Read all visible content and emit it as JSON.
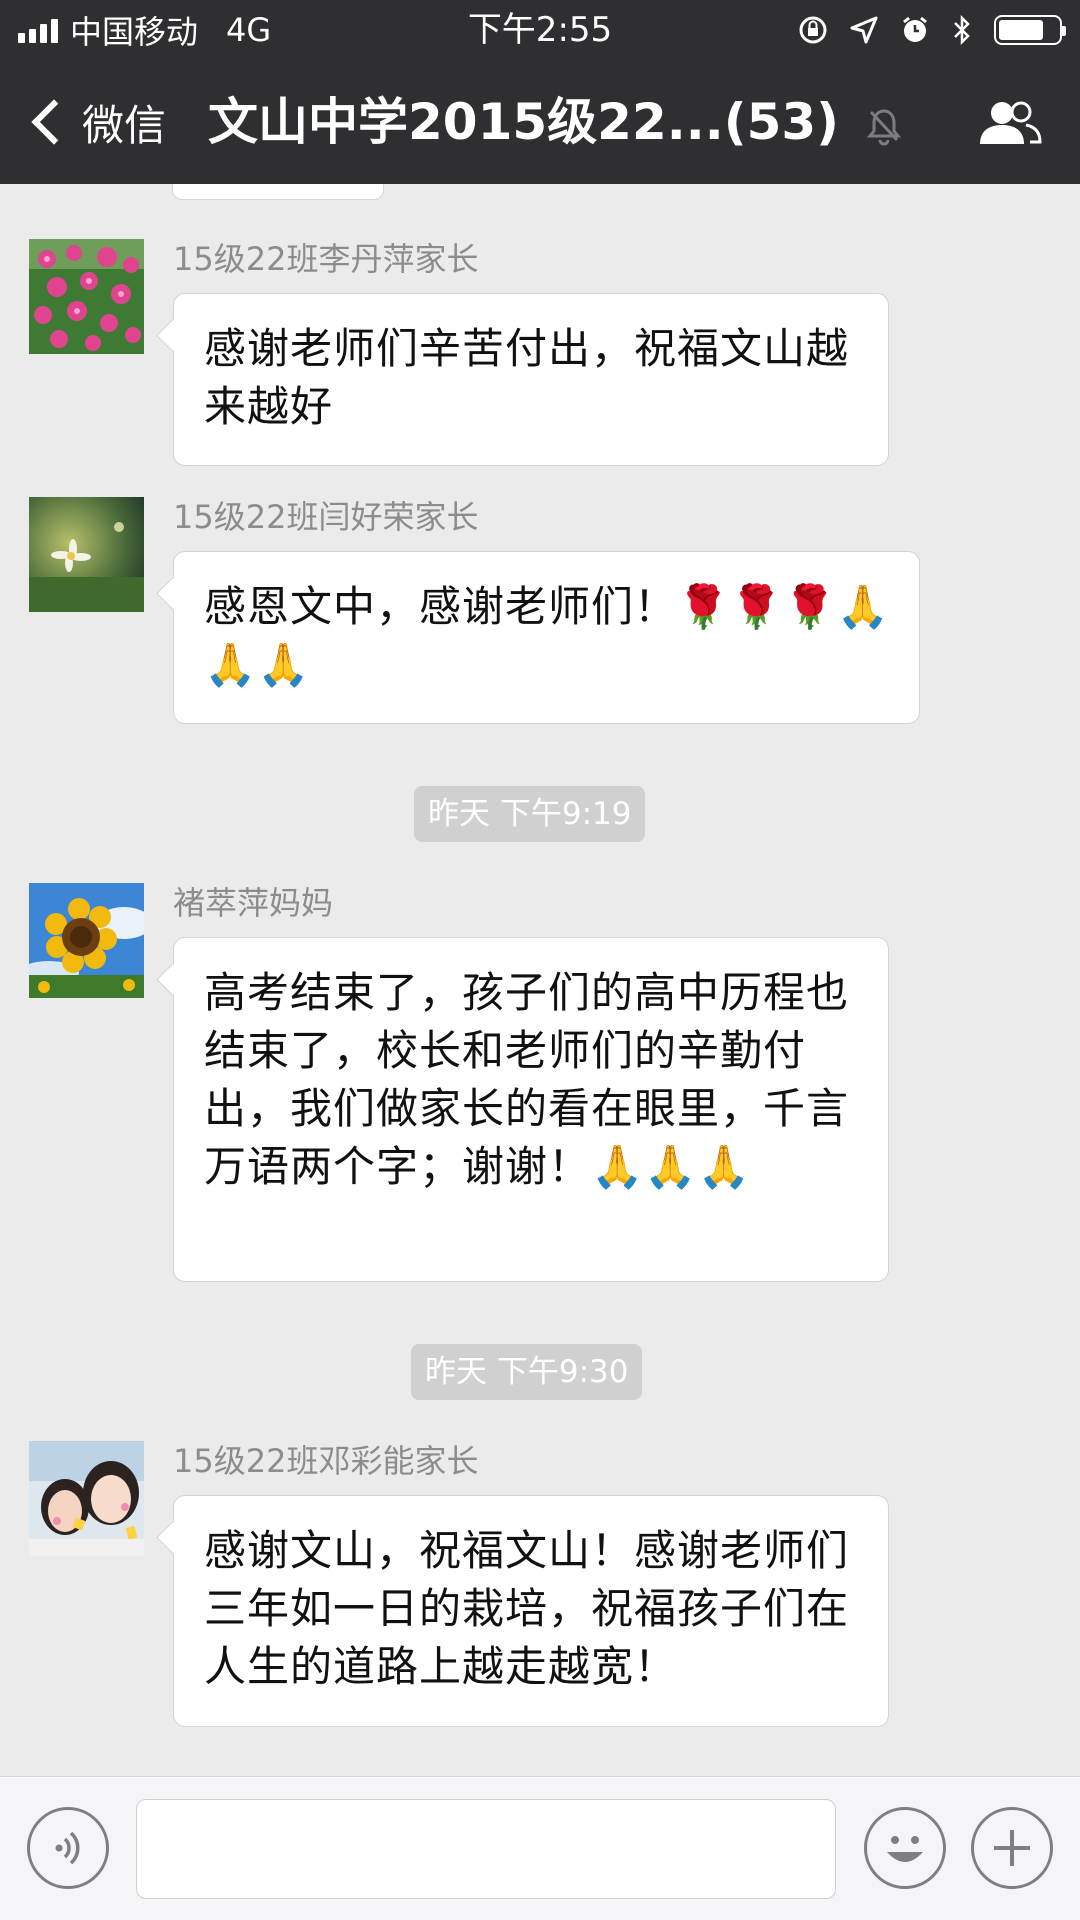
{
  "status_bar": {
    "carrier": "中国移动",
    "network": "4G",
    "time": "下午2:55"
  },
  "nav": {
    "back_label": "微信",
    "title": "文山中学2015级22...(53)",
    "icons": [
      "chevron-left-icon",
      "mute-bell-icon",
      "group-members-icon"
    ]
  },
  "messages": [
    {
      "sender": "15级22班李丹萍家长",
      "avatar": "pink-flowers",
      "text": "感谢老师们辛苦付出，祝福文山越来越好"
    },
    {
      "sender": "15级22班闫好荣家长",
      "avatar": "white-flower-on-grass",
      "text": "感恩文中，感谢老师们！🌹🌹🌹🙏🙏🙏"
    },
    {
      "sender": "褚萃萍妈妈",
      "avatar": "sunflower",
      "text": "高考结束了，孩子们的高中历程也结束了，校长和老师们的辛勤付出，我们做家长的看在眼里，千言万语两个字；谢谢！🙏🙏🙏"
    },
    {
      "sender": "15级22班邓彩能家长",
      "avatar": "two-girls-photo",
      "text": "感谢文山，祝福文山！感谢老师们三年如一日的栽培，祝福孩子们在人生的道路上越走越宽！"
    }
  ],
  "timestamps": [
    "昨天 下午9:19",
    "昨天 下午9:30"
  ],
  "input_bar": {
    "value": "",
    "icons": [
      "voice-icon",
      "emoji-icon",
      "plus-icon"
    ]
  },
  "colors": {
    "bar_bg": "#2f2f31",
    "chat_bg": "#ebebeb",
    "bubble_bg": "#ffffff",
    "time_pill_bg": "#d0d0d0"
  }
}
